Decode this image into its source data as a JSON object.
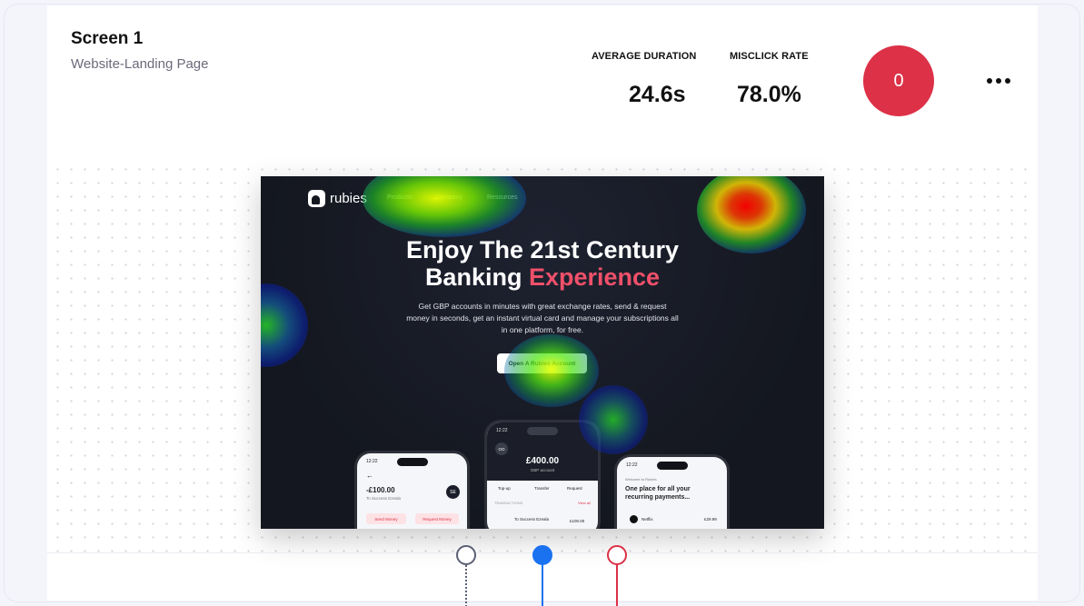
{
  "header": {
    "title": "Screen 1",
    "subtitle": "Website-Landing Page"
  },
  "metrics": [
    {
      "label": "AVERAGE DURATION",
      "value": "24.6s"
    },
    {
      "label": "MISCLICK RATE",
      "value": "78.0%"
    }
  ],
  "count_badge": {
    "value": "0",
    "color": "#dc3147"
  },
  "more_menu": {
    "icon": "more-horizontal-icon"
  },
  "preview": {
    "logo": "rubies",
    "nav": [
      "Products",
      "Company",
      "Resources"
    ],
    "headline_part1": "Enjoy The 21st Century",
    "headline_part2": "Banking",
    "headline_accent": "Experience",
    "accent_color": "#f0506a",
    "description": "Get GBP accounts in minutes with great exchange rates, send & request money in seconds, get an instant virtual card and manage your subscriptions all in one platform, for free.",
    "cta": "Open A Rubies Account",
    "phones": {
      "left": {
        "time": "12:22",
        "amount": "-£100.00",
        "recipient": "To Success Ezeala",
        "initials": "SE",
        "send": "Send Money",
        "request": "Request Money"
      },
      "center": {
        "time": "12:22",
        "initials": "OO",
        "balance": "£400.00",
        "account": "GBP account",
        "topup": "Top-up",
        "transfer": "Transfer",
        "request": "Request",
        "transactions": "TRANSACTIONS",
        "view_all": "View all",
        "tx_name": "To Success Ezeala",
        "tx_amount": "£100.00"
      },
      "right": {
        "time": "12:22",
        "welcome": "Welcome to Rubies",
        "headline": "One place for all your recurring payments...",
        "merchant": "Netflix",
        "price": "£29.99"
      }
    }
  },
  "timeline": {
    "markers": [
      {
        "state": "default",
        "color": "#5c6075"
      },
      {
        "state": "active",
        "color": "#1a72f0"
      },
      {
        "state": "misclick",
        "color": "#dc3147"
      }
    ]
  }
}
